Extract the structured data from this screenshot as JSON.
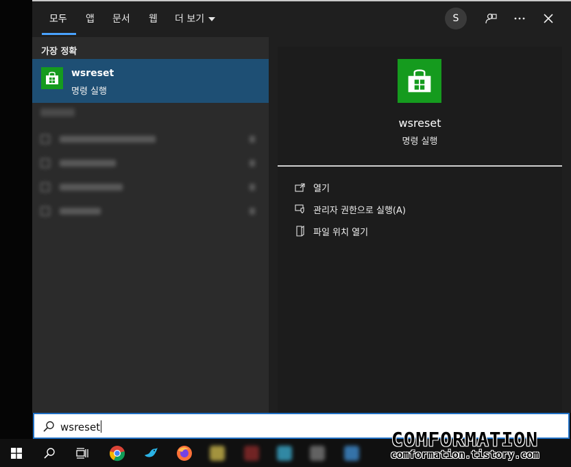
{
  "tabs": [
    {
      "label": "모두",
      "active": true
    },
    {
      "label": "앱"
    },
    {
      "label": "문서"
    },
    {
      "label": "웹"
    },
    {
      "label": "더 보기"
    }
  ],
  "header": {
    "avatar_initial": "S",
    "icons": [
      "feedback-icon",
      "more-icon",
      "close-icon"
    ],
    "accent_color": "#4aa3ff"
  },
  "left": {
    "section_label": "가장 정확",
    "best_match": {
      "title": "wsreset",
      "subtitle": "명령 실행",
      "tile_color": "#159b1e",
      "highlight_color": "#1e4f74"
    }
  },
  "detail": {
    "title": "wsreset",
    "subtitle": "명령 실행",
    "actions": [
      {
        "label": "열기",
        "icon": "open-icon"
      },
      {
        "label": "관리자 권한으로 실행(A)",
        "icon": "shield-icon"
      },
      {
        "label": "파일 위치 열기",
        "icon": "file-location-icon"
      }
    ]
  },
  "search": {
    "value": "wsreset",
    "icon": "search-icon"
  },
  "taskbar": {
    "icons": [
      "windows-start-icon",
      "search-icon",
      "task-view-icon",
      "chrome-icon",
      "bird-app-icon",
      "firefox-icon"
    ]
  },
  "watermark": {
    "title": "COMFORMATION",
    "url": "comformation.tistory.com"
  }
}
